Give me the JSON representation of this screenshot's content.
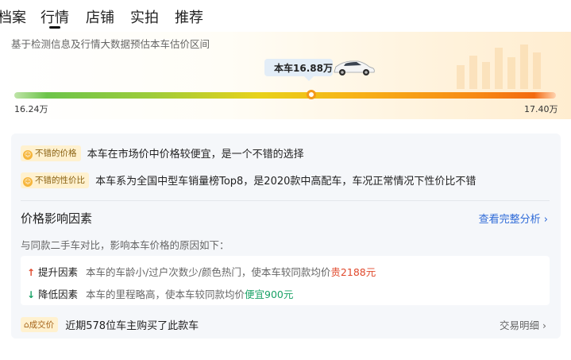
{
  "tabs": [
    {
      "label": "档案"
    },
    {
      "label": "行情"
    },
    {
      "label": "店铺"
    },
    {
      "label": "实拍"
    },
    {
      "label": "推荐"
    }
  ],
  "price_range": {
    "description": "基于检测信息及行情大数据预估本车估价区间",
    "current_label": "本车16.88万",
    "min_label": "16.24万",
    "max_label": "17.40万",
    "current_value": 16.88,
    "min_value": 16.24,
    "max_value": 17.4
  },
  "highlights": [
    {
      "badge": "不错的价格",
      "text": "本车在市场价中价格较便宜，是一个不错的选择"
    },
    {
      "badge": "不错的性价比",
      "text": "本车系为全国中型车销量榜Top8，是2020款中高配车，车况正常情况下性价比不错"
    }
  ],
  "factors": {
    "title": "价格影响因素",
    "link": "查看完整分析",
    "description": "与同款二手车对比，影响本车价格的原因如下：",
    "up": {
      "label": "提升因素",
      "desc": "本车的车龄小/过户次数少/颜色热门，使本车较同款均价",
      "value": "贵2188元"
    },
    "down": {
      "label": "降低因素",
      "desc": "本车的里程略高，使本车较同款均价",
      "value": "便宜900元"
    }
  },
  "deal": {
    "badge": "成交价",
    "text": "近期578位车主购买了此款车",
    "link": "交易明细"
  },
  "colors": {
    "accent_blue": "#2f6bd8",
    "up_red": "#e0492c",
    "down_green": "#1aa266",
    "marker_orange": "#f39a1c"
  }
}
